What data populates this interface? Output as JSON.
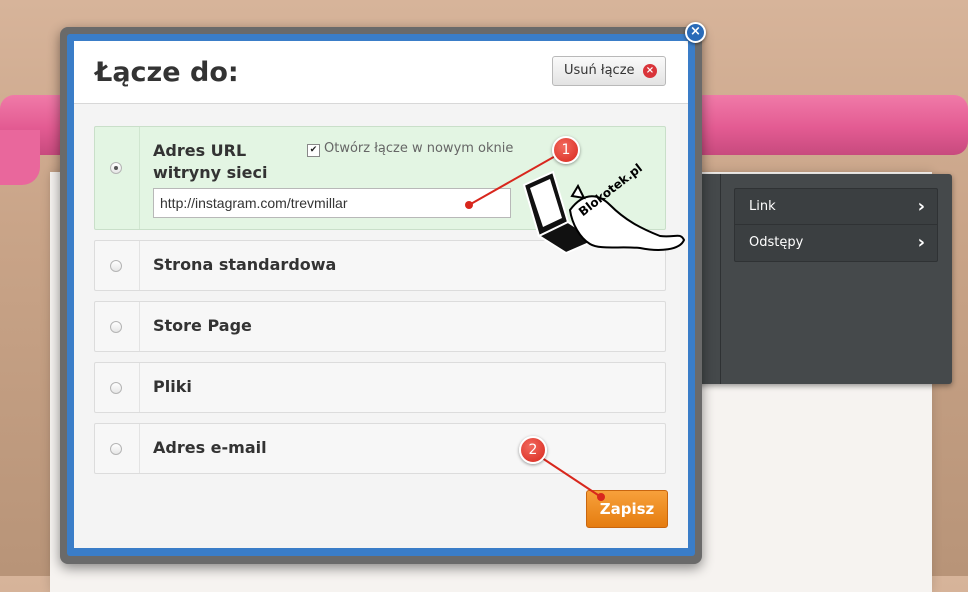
{
  "background": {
    "panel_items": [
      {
        "label": "Link"
      },
      {
        "label": "Odstępy"
      }
    ]
  },
  "dialog": {
    "title": "Łącze do:",
    "remove_button": "Usuń łącze",
    "options": [
      {
        "label": "Adres URL witryny sieci web",
        "selected": true
      },
      {
        "label": "Strona standardowa",
        "selected": false
      },
      {
        "label": "Store Page",
        "selected": false
      },
      {
        "label": "Pliki",
        "selected": false
      },
      {
        "label": "Adres e-mail",
        "selected": false
      }
    ],
    "open_new_window_label": "Otwórz łącze w nowym oknie",
    "open_new_window_checked": true,
    "url_value": "http://instagram.com/trevmillar",
    "save_button": "Zapisz"
  },
  "annotations": {
    "badge1": "1",
    "badge2": "2",
    "watermark": "Blokotek.pl"
  },
  "colors": {
    "accent_blue": "#3a7dc8",
    "save_orange": "#e57c10",
    "selected_green": "#e3f5e3",
    "annotation_red": "#d8271d"
  }
}
